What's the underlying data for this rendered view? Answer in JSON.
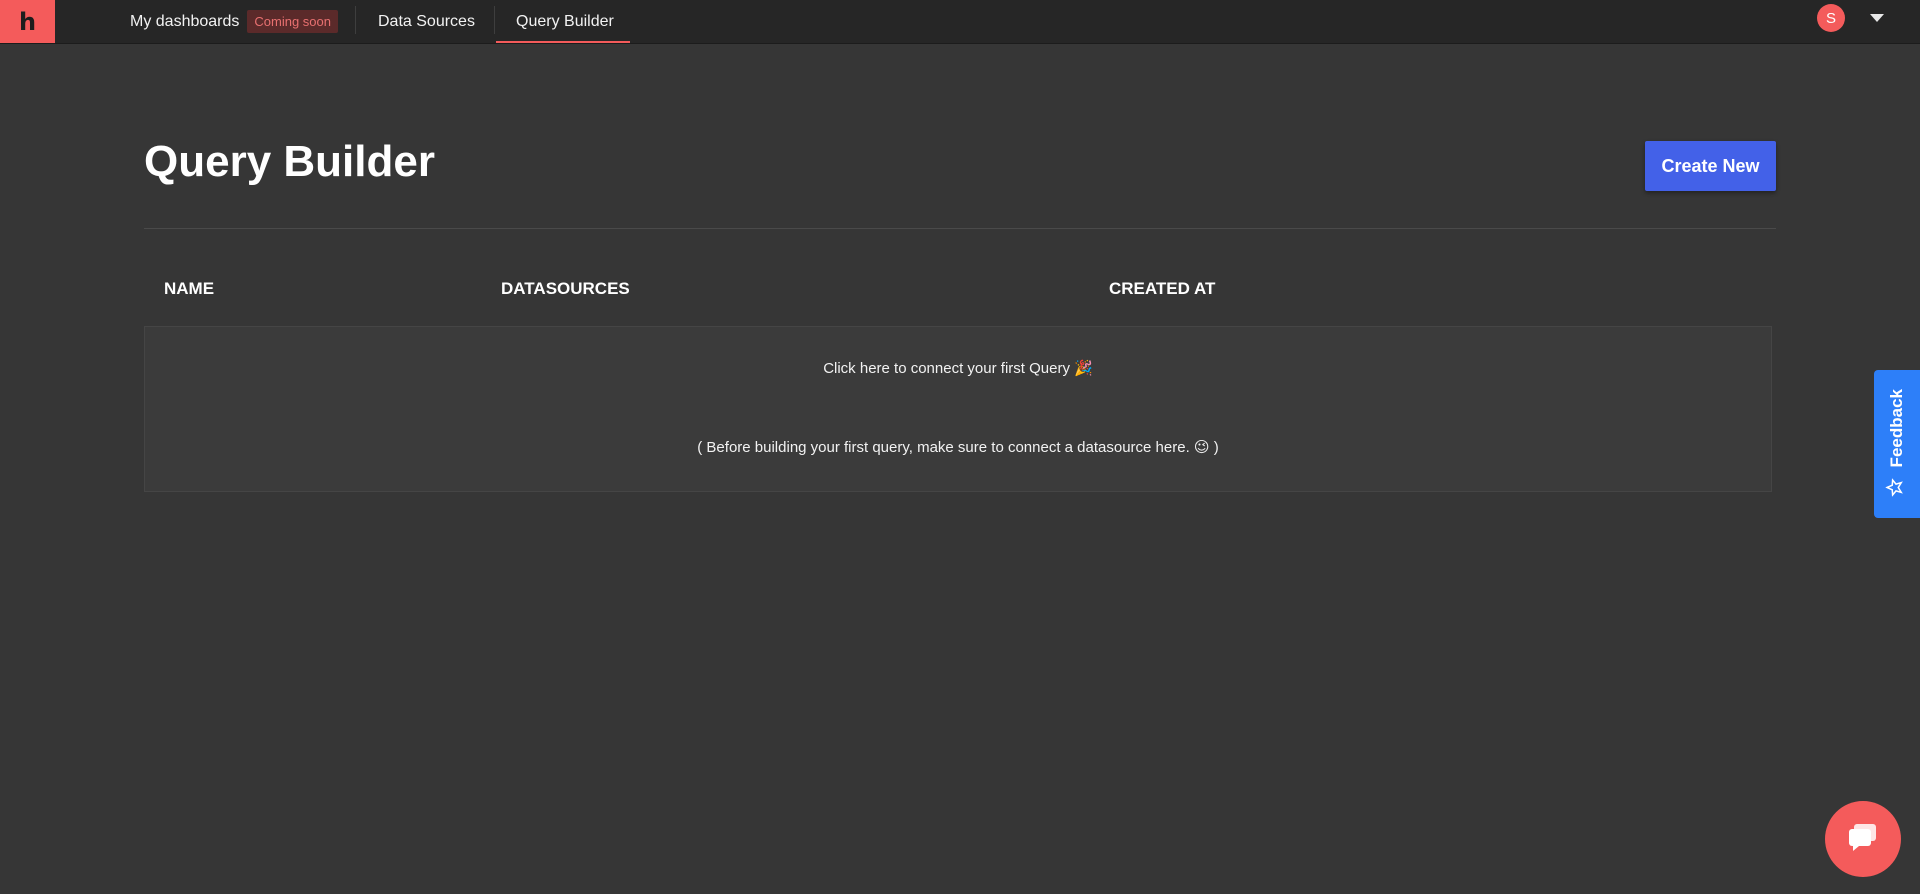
{
  "nav": {
    "logo_letter": "h",
    "items": [
      {
        "label": "My dashboards",
        "badge": "Coming soon"
      },
      {
        "label": "Data Sources"
      },
      {
        "label": "Query Builder",
        "active": true
      }
    ],
    "avatar_initial": "S"
  },
  "page": {
    "title": "Query Builder",
    "create_label": "Create New"
  },
  "table": {
    "columns": [
      "NAME",
      "DATASOURCES",
      "CREATED AT"
    ],
    "empty_line1": "Click here to connect your first Query 🎉",
    "empty_line2": "( Before building your first query, make sure to connect a datasource here. 😉 )"
  },
  "feedback": {
    "label": "Feedback",
    "icon": "sparkle-star-icon"
  },
  "chat": {
    "icon": "chat-bubble-icon"
  },
  "colors": {
    "accent": "#f45b5b",
    "primary_button": "#4361e8",
    "feedback_tab": "#2d7ff9",
    "background": "#363636",
    "topbar": "#262626"
  }
}
